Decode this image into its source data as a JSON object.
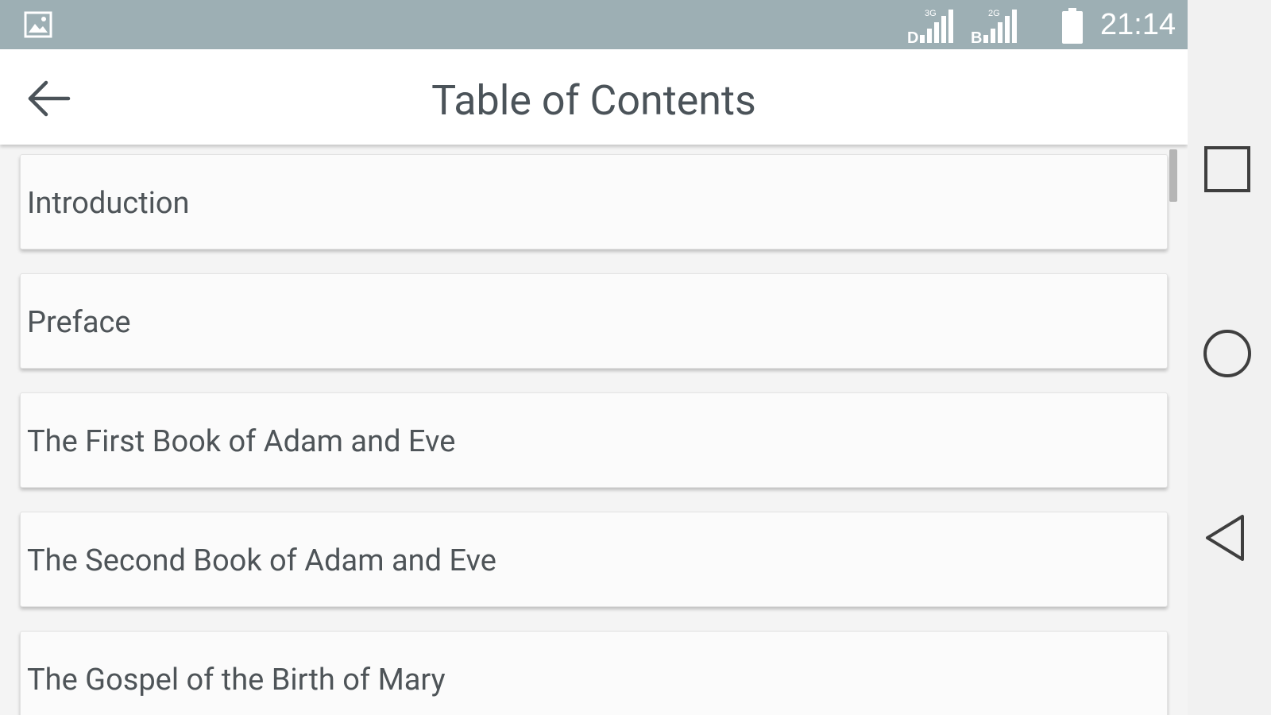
{
  "status_bar": {
    "time": "21:14",
    "icons": [
      "gallery-icon",
      "signal-3g-icon",
      "signal-2g-icon",
      "battery-icon"
    ],
    "background": "#9dafb4"
  },
  "app_bar": {
    "title": "Table of Contents",
    "back_icon": "arrow-left-icon"
  },
  "toc": {
    "items": [
      {
        "label": "Introduction"
      },
      {
        "label": "Preface"
      },
      {
        "label": "The First Book of Adam and Eve"
      },
      {
        "label": "The Second Book of Adam and Eve"
      },
      {
        "label": "The Gospel of the Birth of Mary"
      }
    ]
  },
  "nav_bar": {
    "buttons": [
      "recent-apps-icon",
      "home-icon",
      "back-icon"
    ]
  }
}
